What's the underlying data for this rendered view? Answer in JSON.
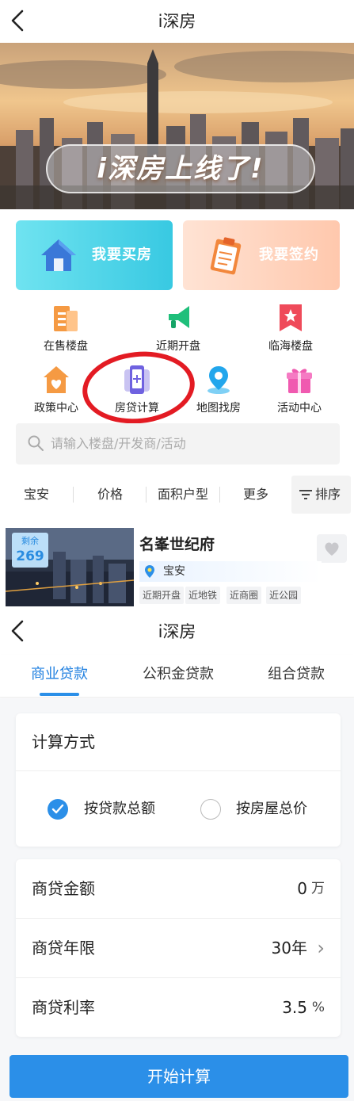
{
  "app": {
    "title": "i深房",
    "back_label": "<"
  },
  "banner": {
    "headline": "i深房上线了!"
  },
  "cards": [
    {
      "label": "我要买房",
      "icon": "house-icon"
    },
    {
      "label": "我要签约",
      "icon": "clipboard-icon"
    }
  ],
  "grid": [
    {
      "label": "在售楼盘",
      "icon": "building-icon"
    },
    {
      "label": "近期开盘",
      "icon": "megaphone-icon"
    },
    {
      "label": "临海楼盘",
      "icon": "bookmark-star-icon"
    },
    {
      "label": "政策中心",
      "icon": "heart-house-icon"
    },
    {
      "label": "房贷计算",
      "icon": "phone-calculator-icon"
    },
    {
      "label": "地图找房",
      "icon": "map-pin-icon"
    },
    {
      "label": "活动中心",
      "icon": "gift-icon"
    }
  ],
  "search": {
    "placeholder": "请输入楼盘/开发商/活动"
  },
  "filters": [
    "宝安",
    "价格",
    "面积户型",
    "更多"
  ],
  "sort_label": "排序",
  "listing": {
    "remain_label": "剩余",
    "remain_count": "269",
    "name": "名峯世纪府",
    "district": "宝安",
    "tags": [
      "近期开盘",
      "近地铁",
      "近商圈",
      "近公园"
    ]
  },
  "calculator": {
    "title": "i深房",
    "tabs": [
      "商业贷款",
      "公积金贷款",
      "组合贷款"
    ],
    "active_tab": 0,
    "method_title": "计算方式",
    "options": [
      {
        "label": "按贷款总额",
        "checked": true
      },
      {
        "label": "按房屋总价",
        "checked": false
      }
    ],
    "rows": [
      {
        "label": "商贷金额",
        "value": "0",
        "unit": "万"
      },
      {
        "label": "商贷年限",
        "value": "30年",
        "unit": "›"
      },
      {
        "label": "商贷利率",
        "value": "3.5",
        "unit": "%"
      }
    ],
    "submit": "开始计算"
  },
  "colors": {
    "accent": "#2b8fe8",
    "highlight_circle": "#e31b23"
  }
}
